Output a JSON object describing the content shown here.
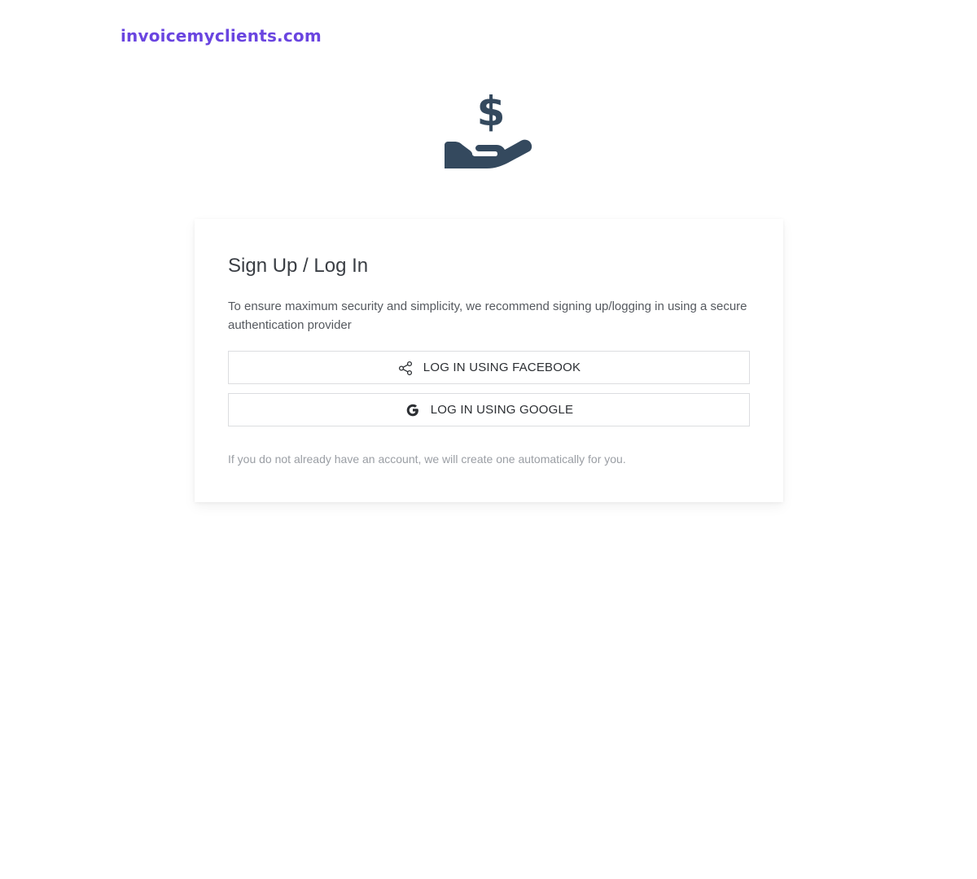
{
  "header": {
    "brand": "invoicemyclients.com"
  },
  "hero": {
    "icon": "hand-holding-dollar-icon"
  },
  "login_card": {
    "title": "Sign Up / Log In",
    "description": "To ensure maximum security and simplicity, we recommend signing up/logging in using a secure authentication provider",
    "facebook_button": {
      "label": "LOG IN USING FACEBOOK",
      "icon": "share-icon"
    },
    "google_button": {
      "label": "LOG IN USING GOOGLE",
      "icon": "google-icon"
    },
    "note": "If you do not already have an account, we will create one automatically for you."
  },
  "colors": {
    "brand": "#6a45e0",
    "icon": "#34495e",
    "button_border": "#dcdde0",
    "note_text": "#9a9ea4"
  }
}
